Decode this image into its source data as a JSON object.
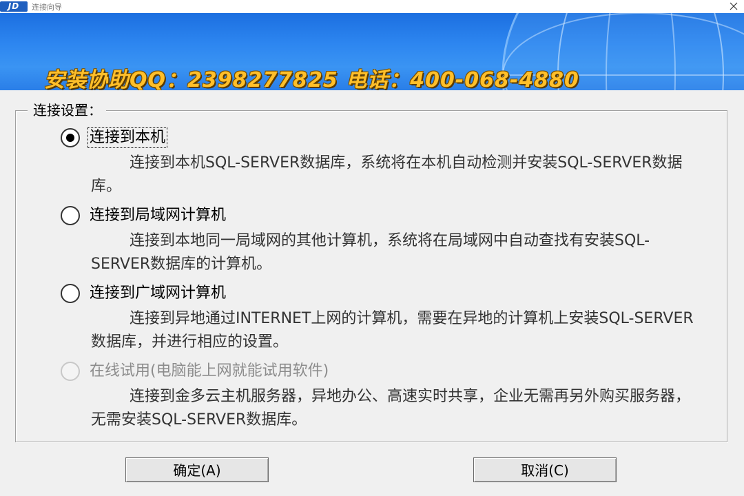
{
  "window": {
    "logo_text": "JD",
    "title": "连接向导"
  },
  "banner": {
    "text": "安装协助QQ：2398277825 电话：400-068-4880"
  },
  "group": {
    "legend": "连接设置："
  },
  "options": [
    {
      "label": "连接到本机",
      "desc": "连接到本机SQL-SERVER数据库，系统将在本机自动检测并安装SQL-SERVER数据库。",
      "checked": true,
      "disabled": false
    },
    {
      "label": "连接到局域网计算机",
      "desc": "连接到本地同一局域网的其他计算机，系统将在局域网中自动查找有安装SQL-SERVER数据库的计算机。",
      "checked": false,
      "disabled": false
    },
    {
      "label": "连接到广域网计算机",
      "desc": "连接到异地通过INTERNET上网的计算机，需要在异地的计算机上安装SQL-SERVER数据库，并进行相应的设置。",
      "checked": false,
      "disabled": false
    },
    {
      "label": "在线试用(电脑能上网就能试用软件)",
      "desc": "连接到金多云主机服务器，异地办公、高速实时共享，企业无需再另外购买服务器，无需安装SQL-SERVER数据库。",
      "checked": false,
      "disabled": true
    }
  ],
  "buttons": {
    "ok": "确定(A)",
    "cancel": "取消(C)"
  },
  "colors": {
    "banner_blue": "#2d86f0",
    "banner_text": "#ffbf2a",
    "window_bg": "#f0f0f0"
  }
}
